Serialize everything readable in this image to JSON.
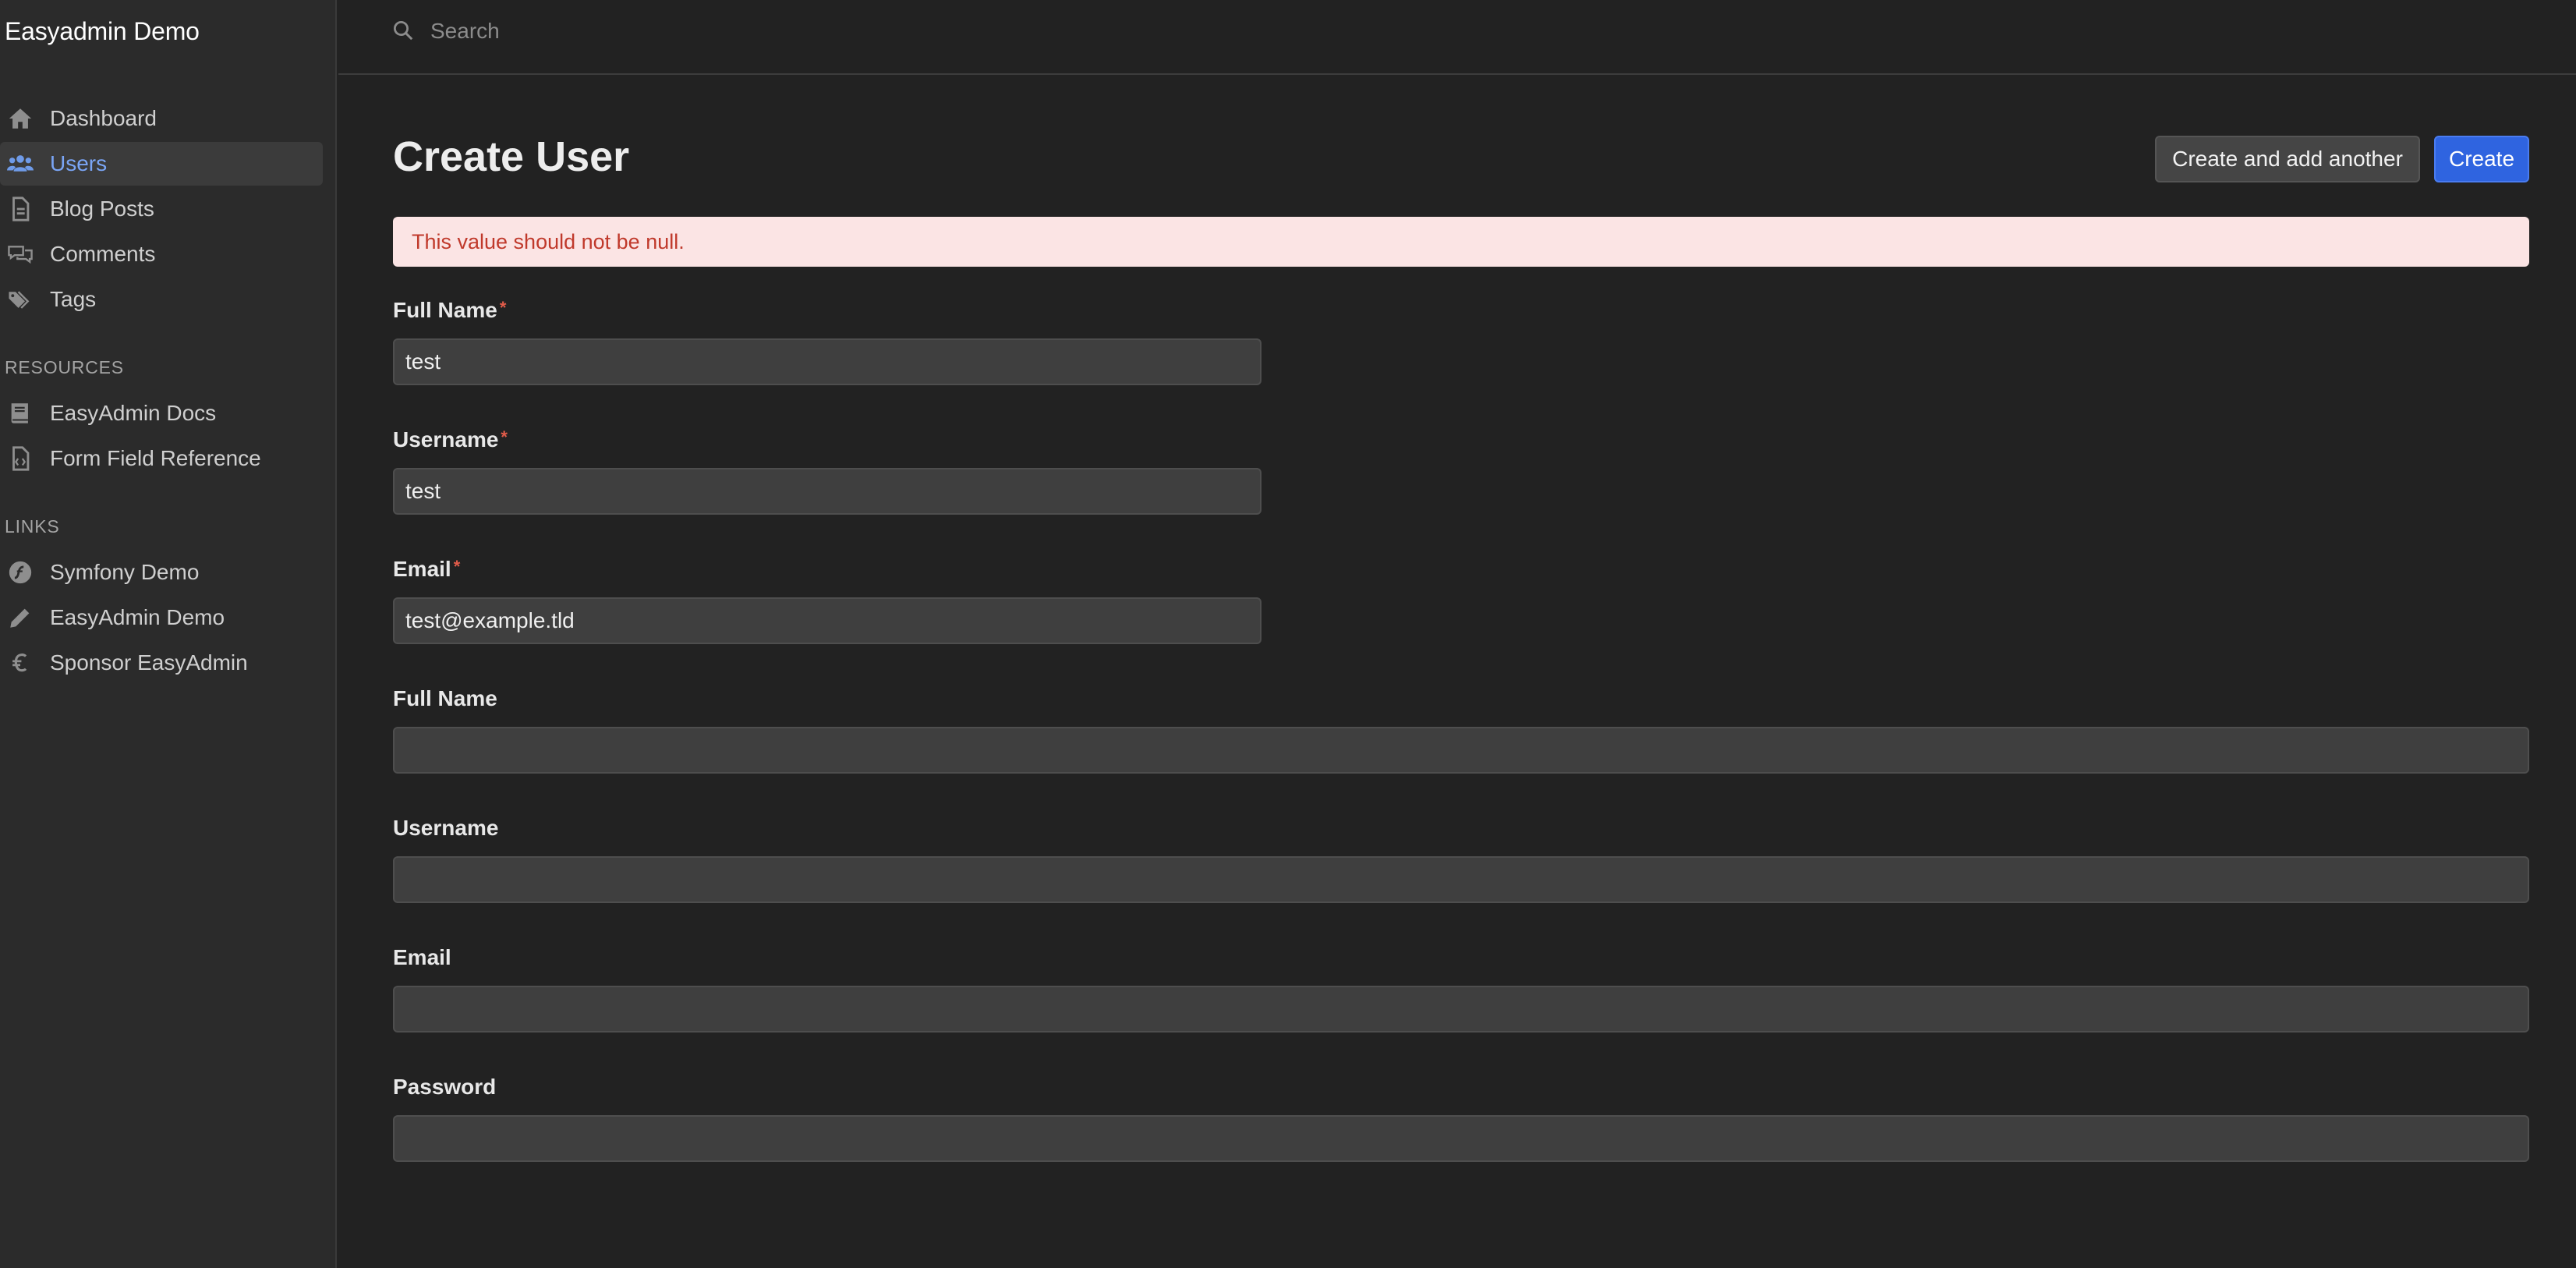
{
  "app": {
    "brand": "Easyadmin Demo"
  },
  "sidebar": {
    "main_items": [
      {
        "label": "Dashboard",
        "icon": "home-icon"
      },
      {
        "label": "Users",
        "icon": "users-icon",
        "active": true
      },
      {
        "label": "Blog Posts",
        "icon": "document-icon"
      },
      {
        "label": "Comments",
        "icon": "comments-icon"
      },
      {
        "label": "Tags",
        "icon": "tags-icon"
      }
    ],
    "resources_title": "RESOURCES",
    "resources": [
      {
        "label": "EasyAdmin Docs",
        "icon": "book-icon"
      },
      {
        "label": "Form Field Reference",
        "icon": "code-file-icon"
      }
    ],
    "links_title": "LINKS",
    "links": [
      {
        "label": "Symfony Demo",
        "icon": "symfony-icon"
      },
      {
        "label": "EasyAdmin Demo",
        "icon": "pencil-icon"
      },
      {
        "label": "Sponsor EasyAdmin",
        "icon": "euro-icon"
      }
    ]
  },
  "search": {
    "placeholder": "Search",
    "value": ""
  },
  "page": {
    "title": "Create User",
    "create_another_label": "Create and add another",
    "create_label": "Create"
  },
  "alert": {
    "message": "This value should not be null."
  },
  "form": {
    "fields": [
      {
        "label": "Full Name",
        "required": true,
        "value": ""
      },
      {
        "label": "Username",
        "required": true,
        "value": ""
      },
      {
        "label": "Email",
        "required": true,
        "value": ""
      },
      {
        "label": "Full Name",
        "required": false,
        "value": ""
      },
      {
        "label": "Username",
        "required": false,
        "value": ""
      },
      {
        "label": "Email",
        "required": false,
        "value": ""
      },
      {
        "label": "Password",
        "required": false,
        "value": ""
      }
    ],
    "values": [
      "test",
      "test",
      "test@example.tld",
      "",
      "",
      "",
      ""
    ],
    "required_mark": "*"
  },
  "colors": {
    "accent": "#2f64e0",
    "active_nav_text": "#7aa5f5",
    "alert_bg": "#fbe4e4",
    "alert_text": "#c0392b",
    "required_mark": "#e25c4a"
  }
}
